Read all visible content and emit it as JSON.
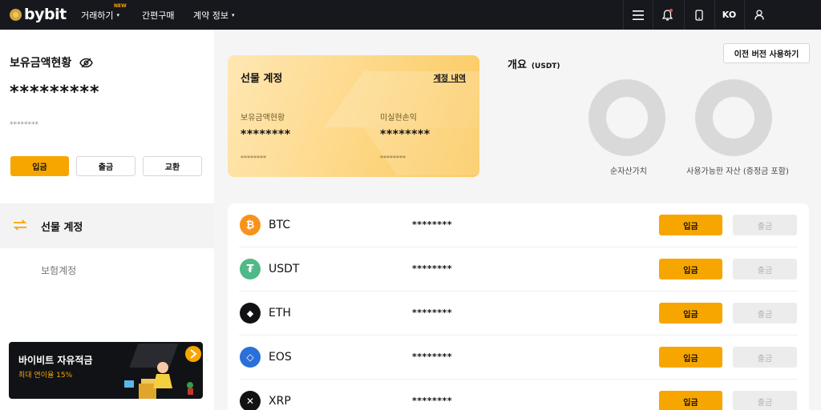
{
  "nav": {
    "logo": "bybit",
    "items": [
      {
        "label": "거래하기",
        "badge": "NEW",
        "has_caret": true
      },
      {
        "label": "간편구매",
        "has_caret": false
      },
      {
        "label": "계약 정보",
        "has_caret": true
      }
    ],
    "caret": "▾",
    "lang": "KO",
    "icons": [
      "menu-icon",
      "bell-icon",
      "mobile-icon",
      "user-icon"
    ]
  },
  "sidebar": {
    "balance_title": "보유금액현황",
    "balance_stars": "*********",
    "balance_sub": "********",
    "buttons": {
      "deposit": "입금",
      "withdraw": "출금",
      "exchange": "교환"
    },
    "items": [
      {
        "label": "선물 계정",
        "selected": true
      },
      {
        "label": "보험계정",
        "selected": false
      }
    ],
    "banner": {
      "title": "바이비트 자유적금",
      "subtitle": "최대 연이율 15%"
    }
  },
  "futures_card": {
    "title": "선물 계정",
    "link": "계정 내역",
    "col1": {
      "label": "보유금액현황",
      "value": "********",
      "sub": "********"
    },
    "col2": {
      "label": "미실현손익",
      "value": "********",
      "sub": "********"
    }
  },
  "overview": {
    "title": "개요",
    "unit": "(USDT)",
    "old_version_button": "이전 버전 사용하기",
    "charts": [
      {
        "label": "순자산가치"
      },
      {
        "label": "사용가능한 자산 (증정금 포함)"
      }
    ]
  },
  "assets": {
    "deposit_label": "입금",
    "withdraw_label": "출금",
    "rows": [
      {
        "coin": "BTC",
        "balance": "********",
        "color": "#f7931a",
        "symbol": "₿"
      },
      {
        "coin": "USDT",
        "balance": "********",
        "color": "#4fb988",
        "symbol": "₮"
      },
      {
        "coin": "ETH",
        "balance": "********",
        "color": "#121214",
        "symbol": "◆"
      },
      {
        "coin": "EOS",
        "balance": "********",
        "color": "#2b6fd8",
        "symbol": "◇"
      },
      {
        "coin": "XRP",
        "balance": "********",
        "color": "#121214",
        "symbol": "✕"
      }
    ]
  },
  "colors": {
    "accent": "#f7a600",
    "nav_bg": "#17181e",
    "disabled": "#ececec"
  }
}
